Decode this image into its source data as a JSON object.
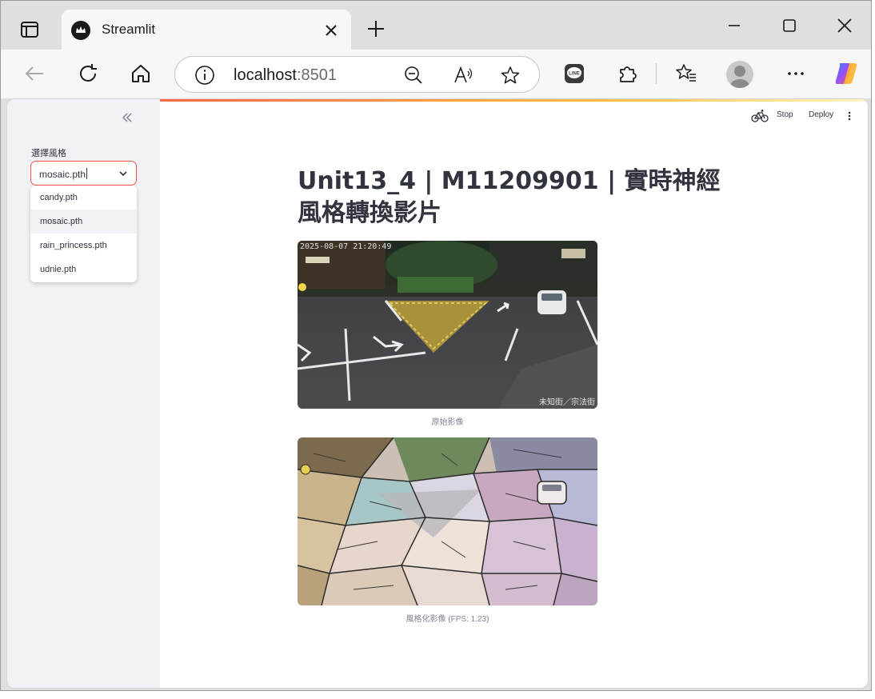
{
  "browser": {
    "tab_title": "Streamlit",
    "url_host": "localhost",
    "url_port": ":8501"
  },
  "app": {
    "header": {
      "stop_label": "Stop",
      "deploy_label": "Deploy"
    },
    "sidebar": {
      "select_label": "選擇風格",
      "select_value": "mosaic.pth",
      "options": [
        "candy.pth",
        "mosaic.pth",
        "rain_princess.pth",
        "udnie.pth"
      ]
    },
    "title": "Unit13_4 | M11209901 | 實時神經風格轉換影片",
    "original": {
      "caption": "原始影像",
      "timestamp": "2025-08-07  21:20:49",
      "street": "未知街／宗法街"
    },
    "stylized": {
      "caption": "風格化影像 (FPS: 1.23)"
    }
  },
  "colors": {
    "accent": "#ff4b4b",
    "sidebar_bg": "#f0f2f6",
    "text": "#31333f"
  }
}
